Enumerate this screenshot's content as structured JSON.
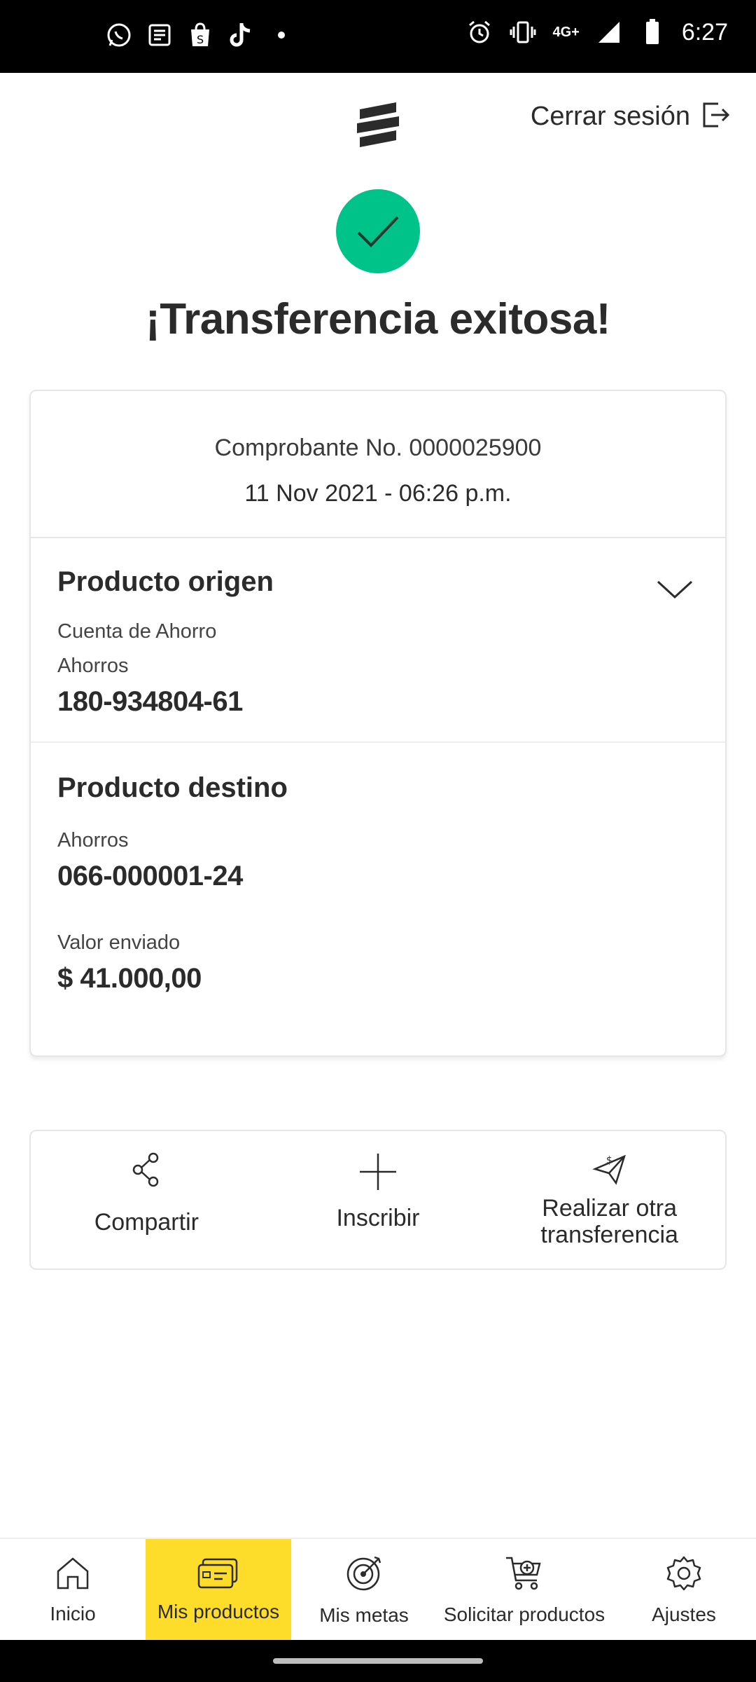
{
  "status_bar": {
    "time": "6:27",
    "network": "4G+",
    "left_icons": [
      "whatsapp-icon",
      "news-icon",
      "shopping-bag-icon",
      "tiktok-icon",
      "dot-icon"
    ],
    "right_icons": [
      "alarm-icon",
      "vibrate-icon",
      "signal-icon",
      "battery-icon"
    ]
  },
  "header": {
    "logout_label": "Cerrar sesión"
  },
  "success": {
    "title": "¡Transferencia exitosa!"
  },
  "receipt": {
    "number": "Comprobante No. 0000025900",
    "datetime": "11 Nov 2021 - 06:26 p.m.",
    "origin": {
      "title": "Producto origen",
      "product_name": "Cuenta de Ahorro",
      "account_type": "Ahorros",
      "account_number": "180-934804-61"
    },
    "destination": {
      "title": "Producto destino",
      "account_type": "Ahorros",
      "account_number": "066-000001-24",
      "amount_label": "Valor enviado",
      "amount": "$ 41.000,00"
    }
  },
  "actions": {
    "share": "Compartir",
    "enroll": "Inscribir",
    "another_transfer": "Realizar otra transferencia"
  },
  "bottom_nav": {
    "home": "Inicio",
    "products": "Mis productos",
    "goals": "Mis metas",
    "request": "Solicitar productos",
    "settings": "Ajustes",
    "active": "products"
  },
  "colors": {
    "success": "#00c389",
    "nav_active": "#fddd2a",
    "text": "#2b2b2b"
  }
}
